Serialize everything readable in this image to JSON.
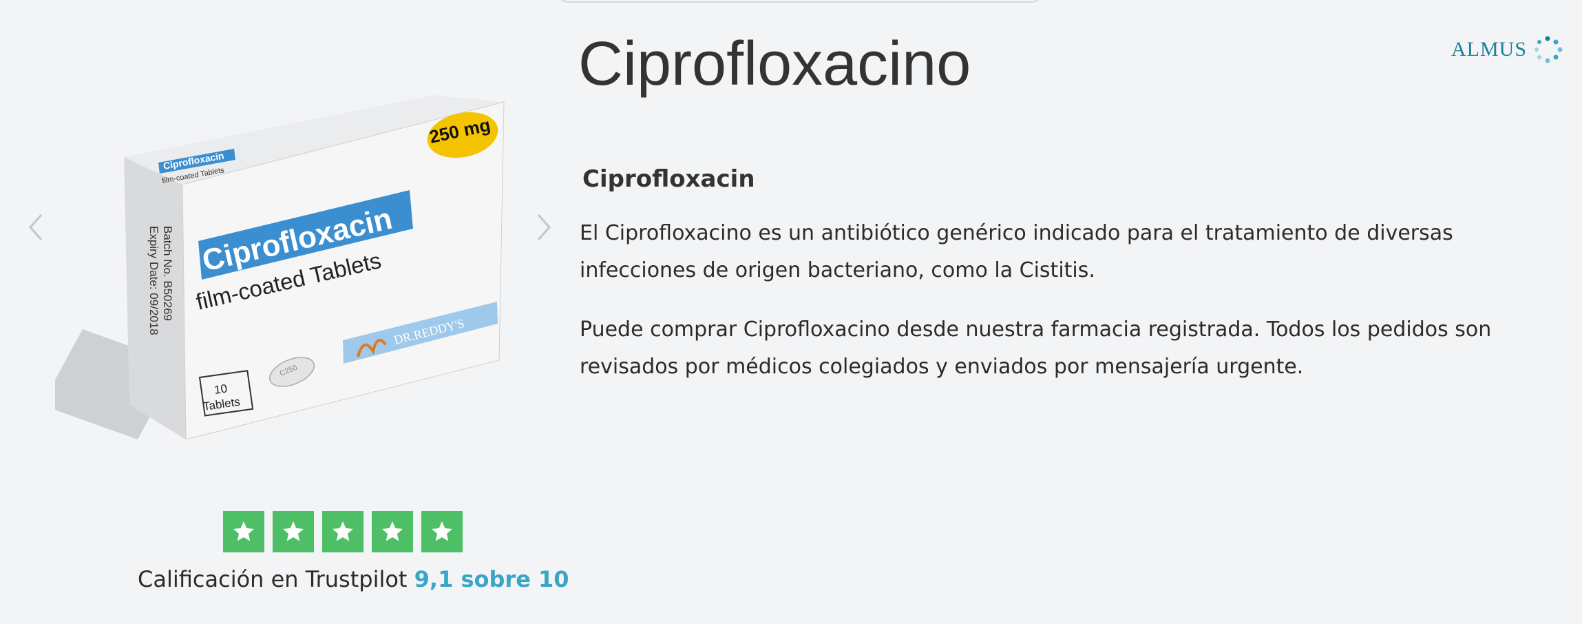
{
  "product": {
    "title": "Ciprofloxacino",
    "subtitle": "Ciprofloxacin",
    "description_1": "El Ciprofloxacino es un antibiótico genérico indicado para el tratamiento de diversas infecciones de origen bacteriano, como la Cistitis.",
    "description_2": "Puede comprar Ciprofloxacino desde nuestra farmacia registrada. Todos los pedidos son revisados por médicos colegiados y enviados por mensajería urgente."
  },
  "brand": {
    "name": "ALMUS",
    "color": "#1c7f99"
  },
  "carousel": {
    "prev_icon": "chevron-left-icon",
    "next_icon": "chevron-right-icon"
  },
  "package": {
    "dose_badge": "250 mg",
    "name": "Ciprofloxacin",
    "form": "film-coated Tablets",
    "count": "10",
    "count_label": "Tablets",
    "batch": "Batch No. B50269",
    "expiry": "Expiry Date: 09/2018",
    "manufacturer": "DR.REDDY'S",
    "tablet_mark": "C250",
    "top_flap_name": "Ciprofloxacin",
    "top_flap_form": "film-coated Tablets"
  },
  "rating": {
    "stars": 5,
    "label": "Calificación en Trustpilot",
    "score": "9,1 sobre 10",
    "star_color": "#4fbf67",
    "score_color": "#3aa6c6"
  }
}
